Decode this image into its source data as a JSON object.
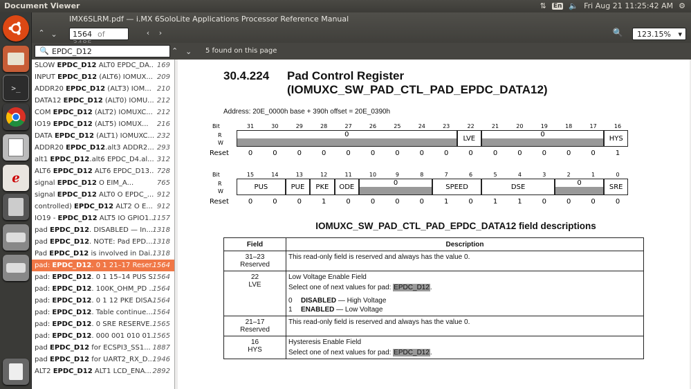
{
  "system": {
    "app_title": "Document Viewer",
    "clock": "Fri Aug 21 11:25:42 AM",
    "keyboard_layout": "En"
  },
  "launcher": {
    "items": [
      "ubuntu-dash",
      "files",
      "terminal",
      "chrome",
      "text-editor",
      "document-viewer",
      "calculator",
      "drive-1",
      "drive-2",
      "trash"
    ]
  },
  "toolbar": {
    "doc_title": "IMX6SLRM.pdf — i.MX 6SoloLite Applications Processor Reference Manual",
    "page_current": "1564",
    "page_total": "of 3485",
    "zoom": "123.15%"
  },
  "find": {
    "query": "EPDC_D12",
    "status": "5 found on this page"
  },
  "results": [
    {
      "pre": "SLOW ",
      "hit": "EPDC_D12",
      "post": " ALT0 EPDC_DA...",
      "page": "169"
    },
    {
      "pre": "INPUT ",
      "hit": "EPDC_D12",
      "post": " (ALT6) IOMUX...",
      "page": "209"
    },
    {
      "pre": "ADDR20 ",
      "hit": "EPDC_D12",
      "post": " (ALT3) IOM...",
      "page": "210"
    },
    {
      "pre": "DATA12 ",
      "hit": "EPDC_D12",
      "post": " (ALT0) IOMU...",
      "page": "212"
    },
    {
      "pre": "COM ",
      "hit": "EPDC_D12",
      "post": " (ALT2) IOMUXC...",
      "page": "212"
    },
    {
      "pre": "IO19 ",
      "hit": "EPDC_D12",
      "post": " (ALT5) IOMUX...",
      "page": "216"
    },
    {
      "pre": "DATA ",
      "hit": "EPDC_D12",
      "post": " (ALT1) IOMUXC...",
      "page": "232"
    },
    {
      "pre": "ADDR20 ",
      "hit": "EPDC_D12",
      "post": ".alt3 ADDR2...",
      "page": "293"
    },
    {
      "pre": "alt1 ",
      "hit": "EPDC_D12",
      "post": ".alt6 EPDC_D4.al...",
      "page": "312"
    },
    {
      "pre": "ALT6 ",
      "hit": "EPDC_D12",
      "post": " ALT6 EPDC_D13...",
      "page": "728"
    },
    {
      "pre": "signal ",
      "hit": "EPDC_D12",
      "post": " O EIM_A...",
      "page": "765"
    },
    {
      "pre": "signal ",
      "hit": "EPDC_D12",
      "post": " ALT0 O EPDC_...",
      "page": "912"
    },
    {
      "pre": "controlled) ",
      "hit": "EPDC_D12",
      "post": " ALT2 O E...",
      "page": "912"
    },
    {
      "pre": "IO19 - ",
      "hit": "EPDC_D12",
      "post": " ALT5 IO GPIO1...",
      "page": "1157"
    },
    {
      "pre": "pad ",
      "hit": "EPDC_D12",
      "post": ". DISABLED — In...",
      "page": "1318"
    },
    {
      "pre": "pad ",
      "hit": "EPDC_D12",
      "post": ". NOTE: Pad EPD...",
      "page": "1318"
    },
    {
      "pre": "Pad ",
      "hit": "EPDC_D12",
      "post": " is involved in Dai...",
      "page": "1318"
    },
    {
      "pre": "pad: ",
      "hit": "EPDC_D12",
      "post": ". 0 1 21–17 Reser...",
      "page": "1564",
      "selected": true
    },
    {
      "pre": "pad: ",
      "hit": "EPDC_D12",
      "post": ". 0 1 15–14 PUS S...",
      "page": "1564"
    },
    {
      "pre": "pad: ",
      "hit": "EPDC_D12",
      "post": ". 100K_OHM_PD ...",
      "page": "1564"
    },
    {
      "pre": "pad: ",
      "hit": "EPDC_D12",
      "post": ". 0 1 12 PKE DISA...",
      "page": "1564"
    },
    {
      "pre": "pad: ",
      "hit": "EPDC_D12",
      "post": ". Table continue...",
      "page": "1564"
    },
    {
      "pre": "pad: ",
      "hit": "EPDC_D12",
      "post": ". 0 SRE RESERVE...",
      "page": "1565"
    },
    {
      "pre": "pad: ",
      "hit": "EPDC_D12",
      "post": ". 000 001 010 01...",
      "page": "1565"
    },
    {
      "pre": "pad ",
      "hit": "EPDC_D12",
      "post": " for ECSPI3_SS1...",
      "page": "1887"
    },
    {
      "pre": "pad ",
      "hit": "EPDC_D12",
      "post": " for UART2_RX_D...",
      "page": "1946"
    },
    {
      "pre": "ALT2 ",
      "hit": "EPDC_D12",
      "post": " ALT1 LCD_ENA...",
      "page": "2892"
    }
  ],
  "doc": {
    "section_number": "30.4.224",
    "section_title_1": "Pad Control Register",
    "section_title_2": "(IOMUXC_SW_PAD_CTL_PAD_EPDC_DATA12)",
    "address": "Address: 20E_0000h base + 390h offset = 20E_0390h",
    "labels": {
      "bit": "Bit",
      "r": "R",
      "w": "W",
      "reset": "Reset"
    },
    "reg_hi": {
      "bits": [
        "31",
        "30",
        "29",
        "28",
        "27",
        "26",
        "25",
        "24",
        "23",
        "22",
        "21",
        "20",
        "19",
        "18",
        "17",
        "16"
      ],
      "fields": [
        {
          "label": "0",
          "span": 9
        },
        {
          "label": "LVE",
          "span": 1
        },
        {
          "label": "0",
          "span": 5
        },
        {
          "label": "HYS",
          "span": 1
        }
      ],
      "reset": [
        "0",
        "0",
        "0",
        "0",
        "0",
        "0",
        "0",
        "0",
        "0",
        "0",
        "0",
        "0",
        "0",
        "0",
        "0",
        "1"
      ]
    },
    "reg_lo": {
      "bits": [
        "15",
        "14",
        "13",
        "12",
        "11",
        "10",
        "9",
        "8",
        "7",
        "6",
        "5",
        "4",
        "3",
        "2",
        "1",
        "0"
      ],
      "fields": [
        {
          "label": "PUS",
          "span": 2
        },
        {
          "label": "PUE",
          "span": 1
        },
        {
          "label": "PKE",
          "span": 1
        },
        {
          "label": "ODE",
          "span": 1
        },
        {
          "label": "0",
          "span": 3
        },
        {
          "label": "SPEED",
          "span": 2
        },
        {
          "label": "DSE",
          "span": 3
        },
        {
          "label": "0",
          "span": 2
        },
        {
          "label": "SRE",
          "span": 1
        }
      ],
      "reset": [
        "0",
        "0",
        "0",
        "1",
        "0",
        "0",
        "0",
        "0",
        "1",
        "0",
        "1",
        "1",
        "0",
        "0",
        "0",
        "0"
      ]
    },
    "fd_title": "IOMUXC_SW_PAD_CTL_PAD_EPDC_DATA12 field descriptions",
    "fd_headers": [
      "Field",
      "Description"
    ],
    "fd_rows": {
      "r1": {
        "bits": "31–23",
        "name": "Reserved",
        "desc": "This read-only field is reserved and always has the value 0."
      },
      "r2": {
        "bits": "22",
        "name": "LVE",
        "desc1": "Low Voltage Enable Field",
        "desc2": "Select one of next values for pad: ",
        "pad": "EPDC_D12",
        "v0": "0",
        "v0name": "DISABLED",
        "v0desc": " — High Voltage",
        "v1": "1",
        "v1name": "ENABLED",
        "v1desc": " — Low Voltage"
      },
      "r3": {
        "bits": "21–17",
        "name": "Reserved",
        "desc": "This read-only field is reserved and always has the value 0."
      },
      "r4": {
        "bits": "16",
        "name": "HYS",
        "desc1": "Hysteresis Enable Field",
        "desc2": "Select one of next values for pad: ",
        "pad": "EPDC_D12"
      }
    }
  }
}
